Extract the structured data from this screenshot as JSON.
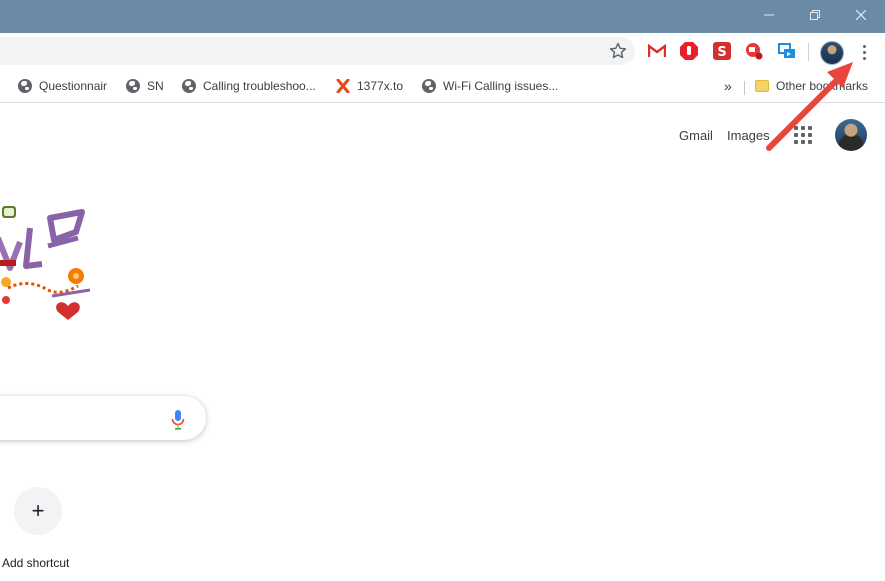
{
  "window": {
    "minimize_icon": "minimize-icon",
    "restore_icon": "restore-icon",
    "close_icon": "close-icon"
  },
  "toolbar": {
    "bookmark_star_icon": "star-icon",
    "extensions": [
      {
        "name": "gmail-extension-icon",
        "color": "#d93025"
      },
      {
        "name": "adblock-extension-icon",
        "color": "#e8202a"
      },
      {
        "name": "s-extension-icon",
        "color": "#d32f2f"
      },
      {
        "name": "video-extension-icon",
        "color": "#e53935"
      },
      {
        "name": "cast-extension-icon",
        "color": "#1a8fe3"
      }
    ],
    "menu_icon": "more-vert-icon"
  },
  "bookmarks": {
    "items": [
      {
        "label": "Questionnair",
        "icon": "globe-icon"
      },
      {
        "label": "SN",
        "icon": "globe-icon"
      },
      {
        "label": "Calling troubleshoo...",
        "icon": "globe-icon"
      },
      {
        "label": "1377x.to",
        "icon": "x-logo-icon"
      },
      {
        "label": "Wi-Fi Calling issues...",
        "icon": "globe-icon"
      }
    ],
    "overflow": "»",
    "other_bookmarks": "Other bookmarks"
  },
  "ntp": {
    "gmail": "Gmail",
    "images": "Images",
    "apps_icon": "apps-grid-icon",
    "add_shortcut_symbol": "+",
    "add_shortcut_label": "Add shortcut"
  },
  "colors": {
    "titlebar": "#6a8aa6",
    "arrow": "#e8453c"
  }
}
